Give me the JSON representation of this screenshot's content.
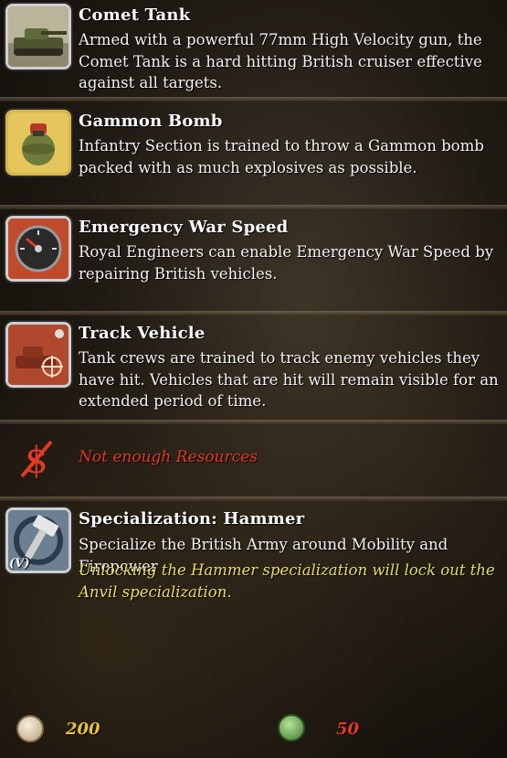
{
  "abilities": [
    {
      "title": "Comet Tank",
      "description": "Armed with a powerful 77mm High Velocity gun, the Comet Tank is a hard hitting British cruiser effective against all targets.",
      "icon": "tank-icon"
    },
    {
      "title": "Gammon Bomb",
      "description": "Infantry Section is trained to throw a Gammon bomb packed with as much explosives as possible.",
      "icon": "grenade-icon"
    },
    {
      "title": "Emergency War Speed",
      "description": "Royal Engineers can enable Emergency War Speed by repairing British vehicles.",
      "icon": "speedometer-icon"
    },
    {
      "title": "Track Vehicle",
      "description": "Tank crews are trained to track enemy vehicles they have hit. Vehicles that are hit will remain visible for an extended period of time.",
      "icon": "tracked-vehicle-icon"
    }
  ],
  "resources_warning": {
    "text": "Not enough Resources",
    "icon": "no-resources-icon"
  },
  "specialization": {
    "title": "Specialization: Hammer",
    "description": "Specialize the British Army around Mobility and Firepower",
    "warning": "Unlocking the Hammer specialization will lock out the Anvil specialization.",
    "hotkey": "(V)",
    "icon": "hammer-icon"
  },
  "costs": [
    {
      "value": "200",
      "icon": "manpower-icon",
      "color": "#e8c13a"
    },
    {
      "value": "50",
      "icon": "fuel-icon",
      "color": "#e23a24"
    }
  ]
}
